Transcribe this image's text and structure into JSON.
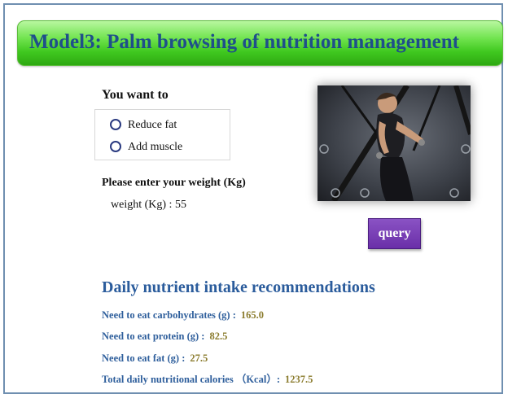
{
  "header": {
    "title": "Model3: Palm browsing of nutrition management"
  },
  "form": {
    "goal_label": "You want to",
    "goal_options": [
      "Reduce fat",
      "Add muscle"
    ],
    "weight_prompt": "Please enter your weight (Kg)",
    "weight_field_label": "weight (Kg) :",
    "weight_value": "55",
    "query_label": "query"
  },
  "results": {
    "title": "Daily nutrient intake recommendations",
    "rows": [
      {
        "label": "Need to eat carbohydrates (g) :",
        "value": "165.0"
      },
      {
        "label": "Need to eat protein (g) :",
        "value": "82.5"
      },
      {
        "label": "Need to eat fat (g) :",
        "value": "27.5"
      },
      {
        "label": "Total daily nutritional calories （Kcal）:",
        "value": "1237.5"
      }
    ]
  },
  "colors": {
    "banner_green": "#4ed12b",
    "title_blue": "#1f4f8a",
    "result_label_blue": "#2f5f9c",
    "result_value_olive": "#8b7c2e",
    "query_purple": "#7a3fb8"
  }
}
